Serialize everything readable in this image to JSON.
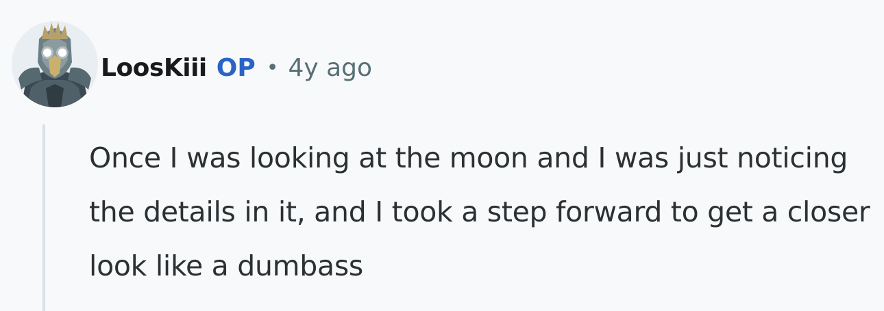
{
  "comment": {
    "author": "LoosKiii",
    "op_badge": "OP",
    "separator": "•",
    "timestamp": "4y ago",
    "avatar_icon": "armored-knight-avatar-icon",
    "body": "Once I was looking at the moon and I was just noticing the details in it, and I took a step forward to get a closer look like a dumbass"
  },
  "colors": {
    "background": "#f8f9fa",
    "username": "#1a1a1b",
    "op_badge": "#2a63c7",
    "meta": "#576f76",
    "body_text": "#2b3033",
    "thread_line": "#dbe1e6"
  }
}
